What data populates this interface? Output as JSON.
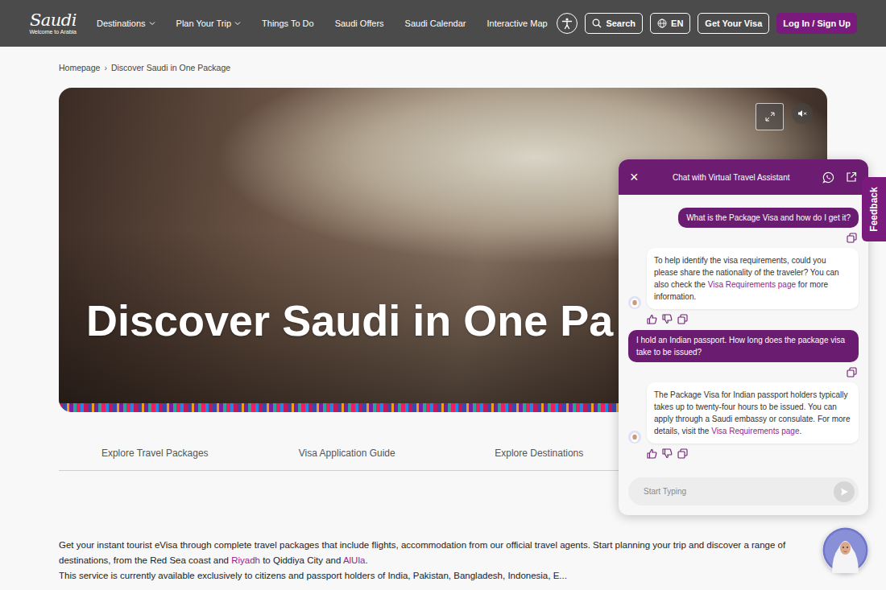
{
  "nav": {
    "logo": "Saudi",
    "logo_tagline": "Welcome to Arabia",
    "items": [
      {
        "label": "Destinations",
        "has_dropdown": true
      },
      {
        "label": "Plan Your Trip",
        "has_dropdown": true
      },
      {
        "label": "Things To Do",
        "has_dropdown": false
      },
      {
        "label": "Saudi Offers",
        "has_dropdown": false
      },
      {
        "label": "Saudi Calendar",
        "has_dropdown": false
      },
      {
        "label": "Interactive Map",
        "has_dropdown": false
      }
    ],
    "search": "Search",
    "language": "EN",
    "visa_button": "Get Your Visa",
    "login_button": "Log In / Sign Up"
  },
  "breadcrumb": {
    "separator": "›",
    "items": [
      {
        "label": "Homepage"
      },
      {
        "label": "Discover Saudi in One Package"
      }
    ]
  },
  "hero": {
    "title": "Discover Saudi in One Pa",
    "muted": true
  },
  "tabs": [
    {
      "label": "Explore Travel Packages",
      "selected": false
    },
    {
      "label": "Visa Application Guide",
      "selected": false
    },
    {
      "label": "Explore Destinations",
      "selected": false
    }
  ],
  "intro": {
    "paragraph": [
      {
        "text": "Get your instant tourist eVisa through complete travel packages that include flights, accommodation from our official travel agents. Start planning your trip and discover a range of destinations, from the Red Sea coast and ",
        "link": false
      },
      {
        "text": "Riyadh",
        "link": true
      },
      {
        "text": " to Qiddiya City and ",
        "link": false
      },
      {
        "text": "AlUla",
        "link": true
      },
      {
        "text": ".",
        "link": false
      }
    ],
    "notice": "This service is currently available exclusively to citizens and passport holders of India, Pakistan, Bangladesh, Indonesia, E..."
  },
  "chat": {
    "title": "Chat with Virtual Travel Assistant",
    "close": "×",
    "input_placeholder": "Start Typing",
    "messages": [
      {
        "kind": "user",
        "segments": [
          {
            "text": "What is the Package Visa and how do I get it?",
            "link": false
          }
        ]
      },
      {
        "kind": "assistant",
        "segments": [
          {
            "text": "To help identify the visa requirements, could you please share the nationality of the traveler? You can also check the ",
            "link": false
          },
          {
            "text": "Visa Requirements page",
            "link": true
          },
          {
            "text": " for more information.",
            "link": false
          }
        ]
      },
      {
        "kind": "user",
        "segments": [
          {
            "text": "I hold an Indian passport. How long does the package visa take to be issued?",
            "link": false
          }
        ]
      },
      {
        "kind": "assistant",
        "segments": [
          {
            "text": "The Package Visa for Indian passport holders typically takes up to twenty-four hours to be issued. You can apply through a Saudi embassy or consulate. For more details, visit the ",
            "link": false
          },
          {
            "text": "Visa Requirements page",
            "link": true
          },
          {
            "text": ".",
            "link": false
          }
        ]
      }
    ]
  },
  "feedback": "Feedback"
}
